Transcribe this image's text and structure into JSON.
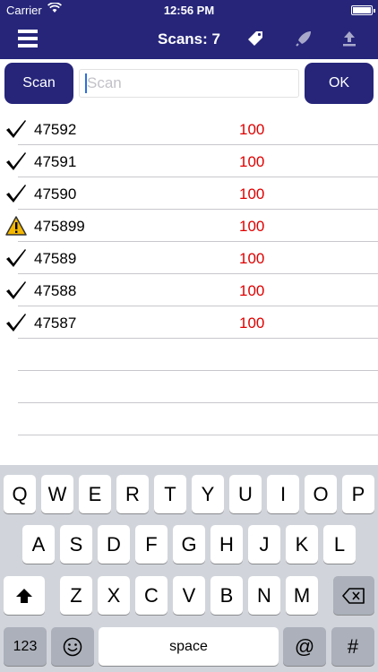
{
  "status_bar": {
    "carrier": "Carrier",
    "time": "12:56 PM"
  },
  "nav": {
    "title": "Scans: 7",
    "icons": [
      "menu-icon",
      "tag-icon",
      "rocket-icon",
      "upload-icon"
    ]
  },
  "scan": {
    "button_label": "Scan",
    "input_placeholder": "Scan",
    "input_value": "",
    "ok_label": "OK"
  },
  "colors": {
    "bar": "#26257a",
    "qty": "#e00000",
    "warning": "#f5b800"
  },
  "items": [
    {
      "status": "check",
      "code": "47592",
      "qty": "100"
    },
    {
      "status": "check",
      "code": "47591",
      "qty": "100"
    },
    {
      "status": "check",
      "code": "47590",
      "qty": "100"
    },
    {
      "status": "warning",
      "code": "475899",
      "qty": "100"
    },
    {
      "status": "check",
      "code": "47589",
      "qty": "100"
    },
    {
      "status": "check",
      "code": "47588",
      "qty": "100"
    },
    {
      "status": "check",
      "code": "47587",
      "qty": "100"
    }
  ],
  "keyboard": {
    "row1": [
      "Q",
      "W",
      "E",
      "R",
      "T",
      "Y",
      "U",
      "I",
      "O",
      "P"
    ],
    "row2": [
      "A",
      "S",
      "D",
      "F",
      "G",
      "H",
      "J",
      "K",
      "L"
    ],
    "row3": [
      "Z",
      "X",
      "C",
      "V",
      "B",
      "N",
      "M"
    ],
    "numbers_label": "123",
    "space_label": "space",
    "at_label": "@",
    "hash_label": "#"
  }
}
